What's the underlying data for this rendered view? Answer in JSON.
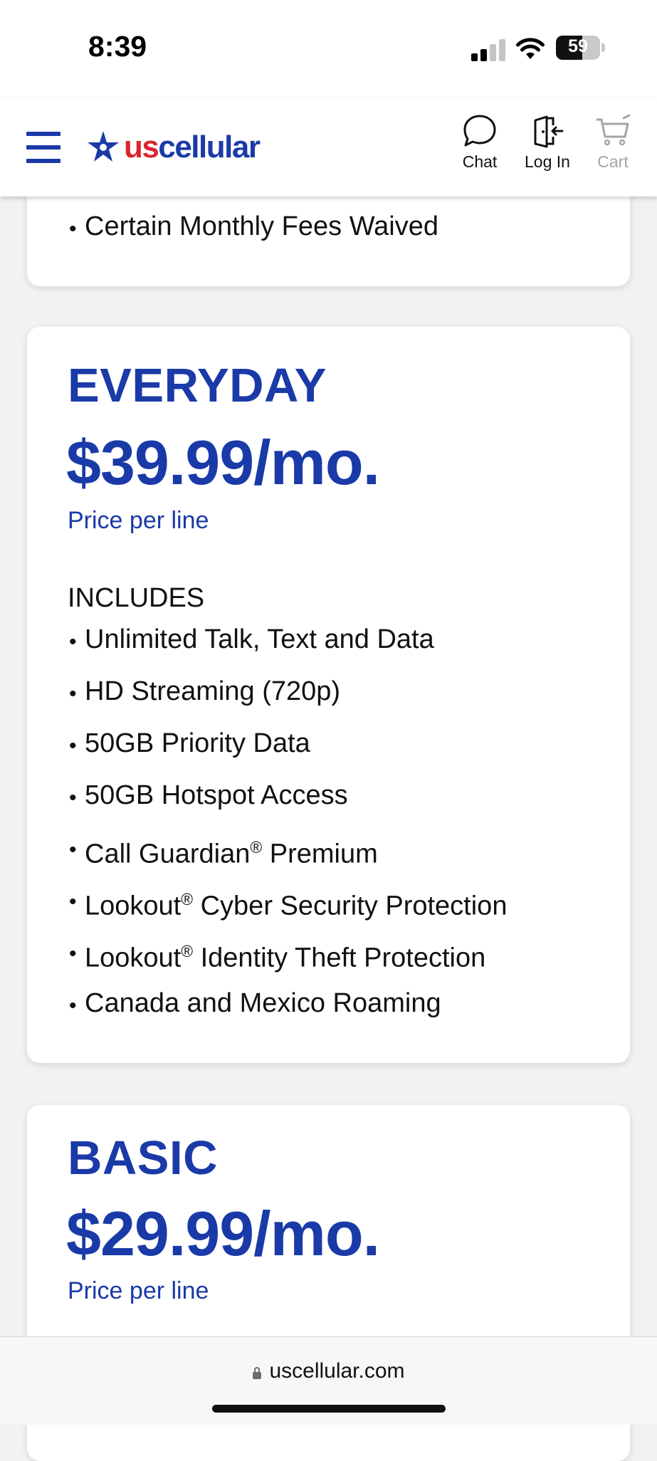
{
  "status_bar": {
    "time": "8:39",
    "battery": "59",
    "battery_level": 0.59
  },
  "header": {
    "logo": {
      "us": "us",
      "cellular": "cellular"
    },
    "chat_label": "Chat",
    "login_label": "Log In",
    "cart_label": "Cart",
    "brand_color": "#1a3aa8",
    "accent_color": "#d9262f"
  },
  "top_card": {
    "items": [
      "Certain Monthly Fees Waived"
    ]
  },
  "everyday_plan": {
    "name": "EVERYDAY",
    "price": "$39.99/mo.",
    "price_note": "Price per line",
    "includes_title": "INCLUDES",
    "features": [
      "Unlimited Talk, Text and Data",
      "HD Streaming (720p)",
      "50GB Priority Data",
      "50GB Hotspot Access",
      "Call Guardian",
      "Premium",
      "Lookout",
      "Cyber Security Protection",
      "Lookout",
      "Identity Theft Protection",
      "Canada and Mexico Roaming"
    ],
    "registered_mark": "®"
  },
  "basic_plan": {
    "name": "BASIC",
    "price": "$29.99/mo.",
    "price_note": "Price per line"
  },
  "browser": {
    "url": "uscellular.com"
  }
}
